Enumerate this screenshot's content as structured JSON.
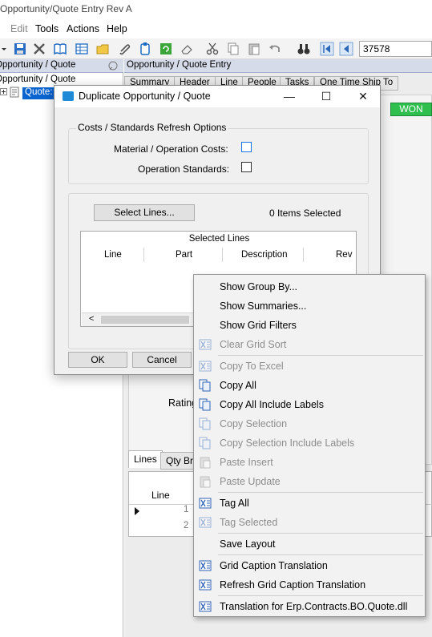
{
  "window": {
    "title": "Opportunity/Quote Entry Rev A"
  },
  "menu": {
    "file": "",
    "edit": "Edit",
    "tools": "Tools",
    "actions": "Actions",
    "help": "Help"
  },
  "toolbar": {
    "id_value": "37578"
  },
  "tree": {
    "header": "Opportunity / Quote",
    "root": "Opportunity / Quote",
    "node": "Quote:"
  },
  "content": {
    "header": "Opportunity / Quote Entry",
    "tabs": [
      "Summary",
      "Header",
      "Line",
      "People",
      "Tasks",
      "One Time Ship To"
    ],
    "status": "WON",
    "rating_label": "Rating",
    "bottom_tabs": [
      "Lines",
      "Qty Bre"
    ],
    "lines_grid": {
      "column": "Line",
      "rows": [
        "1",
        "2"
      ]
    }
  },
  "dialog": {
    "title": "Duplicate Opportunity / Quote",
    "group1_label": "Costs / Standards Refresh Options",
    "material_costs_label": "Material / Operation Costs:",
    "operation_standards_label": "Operation Standards:",
    "select_lines_label": "Select Lines...",
    "items_selected": "0 Items Selected",
    "grid_caption": "Selected Lines",
    "columns": [
      "Line",
      "Part",
      "Description",
      "Rev"
    ],
    "ok_label": "OK",
    "cancel_label": "Cancel"
  },
  "context_menu": {
    "items": [
      {
        "label": "Show Group By...",
        "enabled": true,
        "icon": ""
      },
      {
        "label": "Show Summaries...",
        "enabled": true,
        "icon": ""
      },
      {
        "label": "Show Grid Filters",
        "enabled": true,
        "icon": ""
      },
      {
        "label": "Clear Grid Sort",
        "enabled": false,
        "icon": "excel-icon"
      },
      {
        "label": "Copy To Excel",
        "enabled": false,
        "icon": "excel-icon"
      },
      {
        "label": "Copy All",
        "enabled": true,
        "icon": "copy-icon"
      },
      {
        "label": "Copy All Include Labels",
        "enabled": true,
        "icon": "copy-icon"
      },
      {
        "label": "Copy Selection",
        "enabled": false,
        "icon": "copy-icon"
      },
      {
        "label": "Copy Selection Include Labels",
        "enabled": false,
        "icon": "copy-icon"
      },
      {
        "label": "Paste Insert",
        "enabled": false,
        "icon": "paste-icon"
      },
      {
        "label": "Paste Update",
        "enabled": false,
        "icon": "paste-icon"
      },
      {
        "label": "Tag All",
        "enabled": true,
        "icon": "excel-icon"
      },
      {
        "label": "Tag Selected",
        "enabled": false,
        "icon": "excel-icon"
      },
      {
        "label": "Save Layout",
        "enabled": true,
        "icon": ""
      },
      {
        "label": "Grid Caption Translation",
        "enabled": true,
        "icon": "excel-icon"
      },
      {
        "label": "Refresh Grid Caption Translation",
        "enabled": true,
        "icon": "excel-icon"
      },
      {
        "label": "Translation for Erp.Contracts.BO.Quote.dll",
        "enabled": true,
        "icon": "excel-icon"
      }
    ]
  }
}
